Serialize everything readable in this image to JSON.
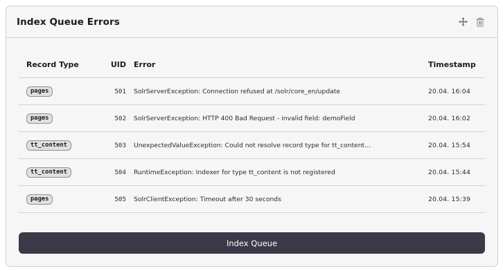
{
  "widget": {
    "title": "Index Queue Errors",
    "actions": [
      {
        "icon": "move-icon"
      },
      {
        "icon": "trash-icon"
      }
    ]
  },
  "table": {
    "columns": {
      "record_type": "Record Type",
      "uid": "UID",
      "error": "Error",
      "timestamp": "Timestamp"
    },
    "rows": [
      {
        "record_type": "pages",
        "uid": "501",
        "error": "SolrServerException: Connection refused at /solr/core_en/update",
        "timestamp": "20.04. 16:04"
      },
      {
        "record_type": "pages",
        "uid": "502",
        "error": "SolrServerException: HTTP 400 Bad Request - invalid field: demoField",
        "timestamp": "20.04. 16:02"
      },
      {
        "record_type": "tt_content",
        "uid": "503",
        "error": "UnexpectedValueException: Could not resolve record type for tt_content…",
        "timestamp": "20.04. 15:54"
      },
      {
        "record_type": "tt_content",
        "uid": "504",
        "error": "RuntimeException: Indexer for type tt_content is not registered",
        "timestamp": "20.04. 15:44"
      },
      {
        "record_type": "pages",
        "uid": "505",
        "error": "SolrClientException: Timeout after 30 seconds",
        "timestamp": "20.04. 15:39"
      }
    ]
  },
  "footer": {
    "button_label": "Index Queue"
  },
  "colors": {
    "button_bg": "#3b3a48",
    "panel_bg": "#f6f6f7",
    "badge_bg": "#e0e0e3"
  }
}
